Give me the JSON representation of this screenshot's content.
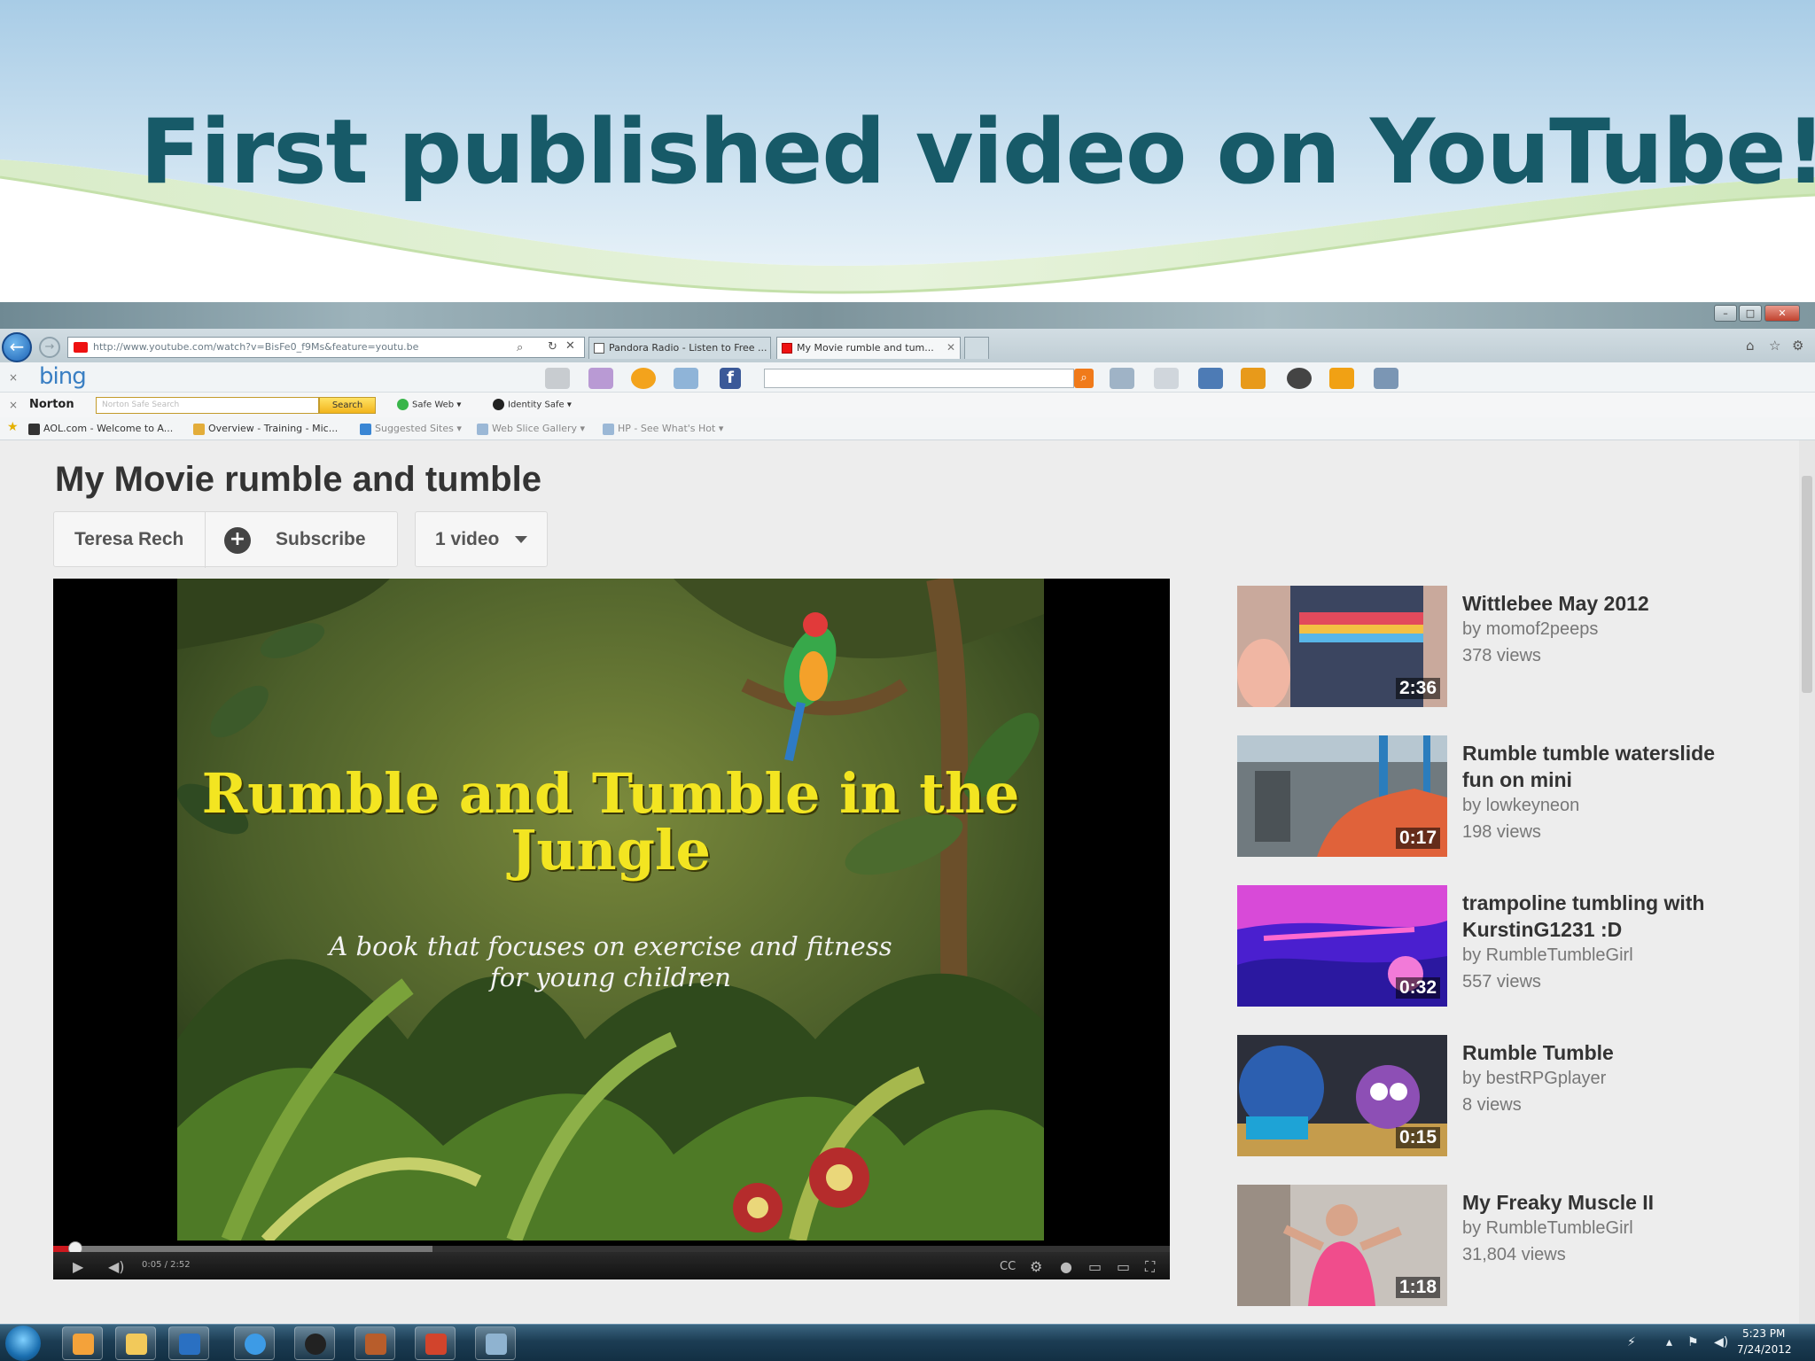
{
  "slide": {
    "title": "First published video on YouTube!"
  },
  "browser": {
    "address_url": "http://www.youtube.com/watch?v=BisFe0_f9Ms&feature=youtu.be",
    "tabs": [
      {
        "label": "Pandora Radio - Listen to Free ..."
      },
      {
        "label": "My Movie rumble and tum..."
      }
    ],
    "bing_label": "bing",
    "norton": {
      "label": "Norton",
      "search_placeholder": "Norton Safe Search",
      "search_button": "Search",
      "safe_web": "Safe Web",
      "identity_safe": "Identity Safe"
    },
    "favorites": [
      {
        "label": "AOL.com - Welcome to A..."
      },
      {
        "label": "Overview - Training - Mic..."
      },
      {
        "label": "Suggested Sites"
      },
      {
        "label": "Web Slice Gallery"
      },
      {
        "label": "HP - See What's Hot"
      }
    ]
  },
  "video_page": {
    "title": "My Movie rumble and tumble",
    "channel_name": "Teresa Rech",
    "subscribe_label": "Subscribe",
    "videos_label": "1 video",
    "video": {
      "title_line1": "Rumble and Tumble in the",
      "title_line2": "Jungle",
      "subtitle_line1": "A book that focuses on exercise and fitness",
      "subtitle_line2": "for young children",
      "time": "0:05 / 2:52",
      "progress": 0.02,
      "buffered": 0.34
    },
    "related": [
      {
        "title": "Wittlebee May 2012",
        "by": "by momof2peeps",
        "views": "378 views",
        "duration": "2:36"
      },
      {
        "title": "Rumble tumble waterslide fun on mini",
        "by": "by lowkeyneon",
        "views": "198 views",
        "duration": "0:17"
      },
      {
        "title": "trampoline tumbling with KurstinG1231 :D",
        "by": "by RumbleTumbleGirl",
        "views": "557 views",
        "duration": "0:32"
      },
      {
        "title": "Rumble Tumble",
        "by": "by bestRPGplayer",
        "views": "8 views",
        "duration": "0:15"
      },
      {
        "title": "My Freaky Muscle II",
        "by": "by RumbleTumbleGirl",
        "views": "31,804 views",
        "duration": "1:18"
      }
    ]
  },
  "taskbar": {
    "time": "5:23 PM",
    "date": "7/24/2012"
  },
  "colors": {
    "slide_title": "#175a68",
    "progress_played": "#cc181e",
    "video_title_text": "#f3e521"
  }
}
